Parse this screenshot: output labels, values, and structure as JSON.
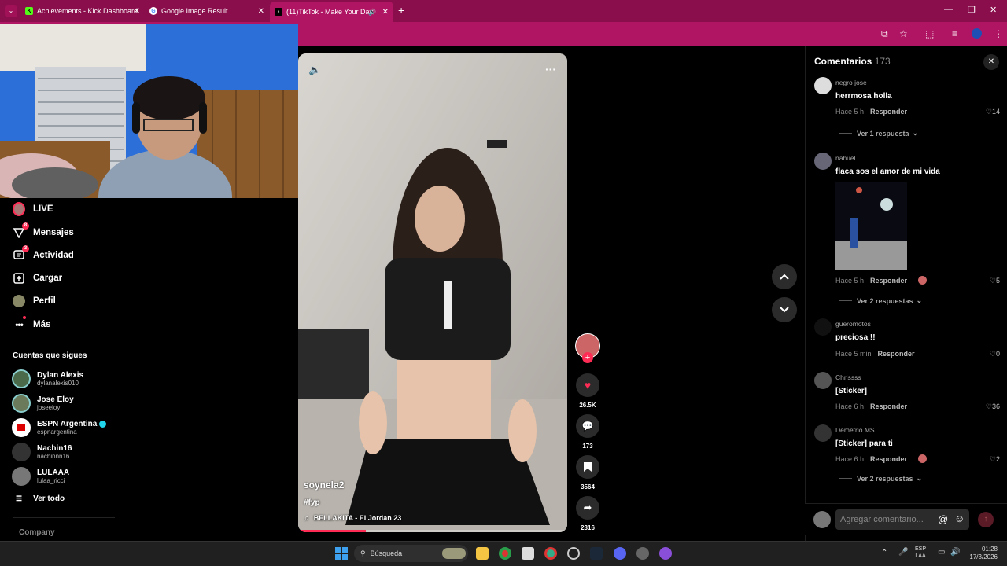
{
  "browser": {
    "tabs": [
      {
        "title": "Achievements - Kick Dashboard",
        "favicon": "K"
      },
      {
        "title": "Google Image Result",
        "favicon": "G"
      },
      {
        "title": "(11)TikTok - Make Your Day",
        "favicon": "♪"
      }
    ],
    "new_tab_label": "+",
    "accent": "#b01563"
  },
  "sidebar": {
    "nav": [
      {
        "label": "LIVE",
        "icon": "live-icon",
        "badge": ""
      },
      {
        "label": "Mensajes",
        "icon": "messages-icon",
        "badge": "8"
      },
      {
        "label": "Actividad",
        "icon": "activity-icon",
        "badge": "3"
      },
      {
        "label": "Cargar",
        "icon": "upload-icon",
        "badge": ""
      },
      {
        "label": "Perfil",
        "icon": "profile-icon",
        "badge": ""
      },
      {
        "label": "Más",
        "icon": "more-icon",
        "badge": ""
      }
    ],
    "following_title": "Cuentas que sigues",
    "accounts": [
      {
        "name": "Dylan Alexis",
        "username": "dylanalexis010"
      },
      {
        "name": "Jose Eloy",
        "username": "joseeloy"
      },
      {
        "name": "ESPN Argentina",
        "username": "espnargentina"
      },
      {
        "name": "Nachin16",
        "username": "nachinnn16"
      },
      {
        "name": "LULAAA",
        "username": "lulaa_ricci"
      }
    ],
    "see_all": "Ver todo",
    "company": "Company"
  },
  "video": {
    "author": "soynela2",
    "hashtag": "#fyp",
    "music": "BELLAKITA - El Jordan 23",
    "progress": 0.25
  },
  "actions": {
    "likes": "26.5K",
    "comments": "173",
    "saves": "3564",
    "shares": "2316"
  },
  "comments": {
    "title": "Comentarios",
    "count": "173",
    "items": [
      {
        "user": "negro jose",
        "text": "herrmosa holla",
        "time": "Hace 5 h",
        "reply": "Responder",
        "likes": "14",
        "replies": "Ver 1 respuesta"
      },
      {
        "user": "nahuel",
        "text": "flaca sos el amor de mi vida",
        "time": "Hace 5 h",
        "reply": "Responder",
        "likes": "5",
        "replies": "Ver 2 respuestas"
      },
      {
        "user": "gueromotos",
        "text": "preciosa !!",
        "time": "Hace 5 min",
        "reply": "Responder",
        "likes": "0",
        "replies": ""
      },
      {
        "user": "Chrissss",
        "text": "[Sticker]",
        "time": "Hace 6 h",
        "reply": "Responder",
        "likes": "36",
        "replies": ""
      },
      {
        "user": "Demetrio MS",
        "text": "[Sticker] para ti",
        "time": "Hace 6 h",
        "reply": "Responder",
        "likes": "2",
        "replies": "Ver 2 respuestas"
      }
    ],
    "input_placeholder": "Agregar comentario..."
  },
  "taskbar": {
    "search": "Búsqueda",
    "lang": "ESP",
    "layout": "LAA",
    "time": "01:28",
    "date": "17/3/2026"
  }
}
